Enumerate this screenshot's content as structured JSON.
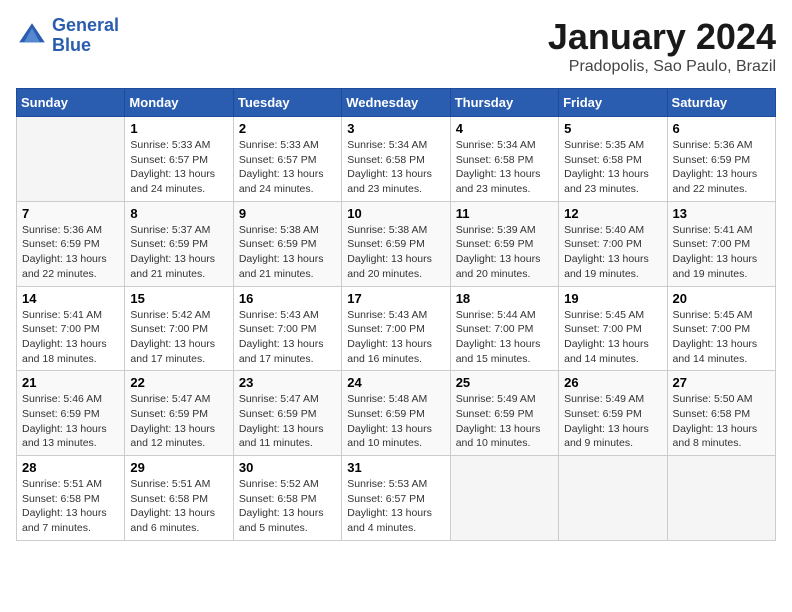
{
  "header": {
    "logo_line1": "General",
    "logo_line2": "Blue",
    "month_title": "January 2024",
    "subtitle": "Pradopolis, Sao Paulo, Brazil"
  },
  "days_of_week": [
    "Sunday",
    "Monday",
    "Tuesday",
    "Wednesday",
    "Thursday",
    "Friday",
    "Saturday"
  ],
  "weeks": [
    [
      {
        "num": "",
        "info": ""
      },
      {
        "num": "1",
        "info": "Sunrise: 5:33 AM\nSunset: 6:57 PM\nDaylight: 13 hours\nand 24 minutes."
      },
      {
        "num": "2",
        "info": "Sunrise: 5:33 AM\nSunset: 6:57 PM\nDaylight: 13 hours\nand 24 minutes."
      },
      {
        "num": "3",
        "info": "Sunrise: 5:34 AM\nSunset: 6:58 PM\nDaylight: 13 hours\nand 23 minutes."
      },
      {
        "num": "4",
        "info": "Sunrise: 5:34 AM\nSunset: 6:58 PM\nDaylight: 13 hours\nand 23 minutes."
      },
      {
        "num": "5",
        "info": "Sunrise: 5:35 AM\nSunset: 6:58 PM\nDaylight: 13 hours\nand 23 minutes."
      },
      {
        "num": "6",
        "info": "Sunrise: 5:36 AM\nSunset: 6:59 PM\nDaylight: 13 hours\nand 22 minutes."
      }
    ],
    [
      {
        "num": "7",
        "info": "Sunrise: 5:36 AM\nSunset: 6:59 PM\nDaylight: 13 hours\nand 22 minutes."
      },
      {
        "num": "8",
        "info": "Sunrise: 5:37 AM\nSunset: 6:59 PM\nDaylight: 13 hours\nand 21 minutes."
      },
      {
        "num": "9",
        "info": "Sunrise: 5:38 AM\nSunset: 6:59 PM\nDaylight: 13 hours\nand 21 minutes."
      },
      {
        "num": "10",
        "info": "Sunrise: 5:38 AM\nSunset: 6:59 PM\nDaylight: 13 hours\nand 20 minutes."
      },
      {
        "num": "11",
        "info": "Sunrise: 5:39 AM\nSunset: 6:59 PM\nDaylight: 13 hours\nand 20 minutes."
      },
      {
        "num": "12",
        "info": "Sunrise: 5:40 AM\nSunset: 7:00 PM\nDaylight: 13 hours\nand 19 minutes."
      },
      {
        "num": "13",
        "info": "Sunrise: 5:41 AM\nSunset: 7:00 PM\nDaylight: 13 hours\nand 19 minutes."
      }
    ],
    [
      {
        "num": "14",
        "info": "Sunrise: 5:41 AM\nSunset: 7:00 PM\nDaylight: 13 hours\nand 18 minutes."
      },
      {
        "num": "15",
        "info": "Sunrise: 5:42 AM\nSunset: 7:00 PM\nDaylight: 13 hours\nand 17 minutes."
      },
      {
        "num": "16",
        "info": "Sunrise: 5:43 AM\nSunset: 7:00 PM\nDaylight: 13 hours\nand 17 minutes."
      },
      {
        "num": "17",
        "info": "Sunrise: 5:43 AM\nSunset: 7:00 PM\nDaylight: 13 hours\nand 16 minutes."
      },
      {
        "num": "18",
        "info": "Sunrise: 5:44 AM\nSunset: 7:00 PM\nDaylight: 13 hours\nand 15 minutes."
      },
      {
        "num": "19",
        "info": "Sunrise: 5:45 AM\nSunset: 7:00 PM\nDaylight: 13 hours\nand 14 minutes."
      },
      {
        "num": "20",
        "info": "Sunrise: 5:45 AM\nSunset: 7:00 PM\nDaylight: 13 hours\nand 14 minutes."
      }
    ],
    [
      {
        "num": "21",
        "info": "Sunrise: 5:46 AM\nSunset: 6:59 PM\nDaylight: 13 hours\nand 13 minutes."
      },
      {
        "num": "22",
        "info": "Sunrise: 5:47 AM\nSunset: 6:59 PM\nDaylight: 13 hours\nand 12 minutes."
      },
      {
        "num": "23",
        "info": "Sunrise: 5:47 AM\nSunset: 6:59 PM\nDaylight: 13 hours\nand 11 minutes."
      },
      {
        "num": "24",
        "info": "Sunrise: 5:48 AM\nSunset: 6:59 PM\nDaylight: 13 hours\nand 10 minutes."
      },
      {
        "num": "25",
        "info": "Sunrise: 5:49 AM\nSunset: 6:59 PM\nDaylight: 13 hours\nand 10 minutes."
      },
      {
        "num": "26",
        "info": "Sunrise: 5:49 AM\nSunset: 6:59 PM\nDaylight: 13 hours\nand 9 minutes."
      },
      {
        "num": "27",
        "info": "Sunrise: 5:50 AM\nSunset: 6:58 PM\nDaylight: 13 hours\nand 8 minutes."
      }
    ],
    [
      {
        "num": "28",
        "info": "Sunrise: 5:51 AM\nSunset: 6:58 PM\nDaylight: 13 hours\nand 7 minutes."
      },
      {
        "num": "29",
        "info": "Sunrise: 5:51 AM\nSunset: 6:58 PM\nDaylight: 13 hours\nand 6 minutes."
      },
      {
        "num": "30",
        "info": "Sunrise: 5:52 AM\nSunset: 6:58 PM\nDaylight: 13 hours\nand 5 minutes."
      },
      {
        "num": "31",
        "info": "Sunrise: 5:53 AM\nSunset: 6:57 PM\nDaylight: 13 hours\nand 4 minutes."
      },
      {
        "num": "",
        "info": ""
      },
      {
        "num": "",
        "info": ""
      },
      {
        "num": "",
        "info": ""
      }
    ]
  ]
}
